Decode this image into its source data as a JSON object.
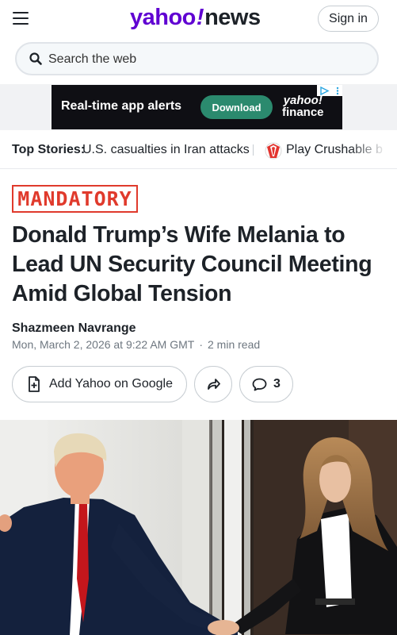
{
  "header": {
    "logo_left": "yahoo",
    "logo_bang": "!",
    "logo_right": "news",
    "signin_label": "Sign in"
  },
  "search": {
    "placeholder": "Search the web"
  },
  "ad": {
    "headline": "Real-time app alerts",
    "cta": "Download",
    "brand_line1": "yahoo!",
    "brand_line2": "finance"
  },
  "top_stories": {
    "label": "Top Stories:",
    "items": [
      {
        "text": "U.S. casualties in Iran attacks"
      },
      {
        "text": "Play Crushable b"
      }
    ]
  },
  "article": {
    "badge": "MANDATORY",
    "headline": "Donald Trump’s Wife Melania to Lead UN Security Council Meeting Amid Global Tension",
    "author": "Shazmeen Navrange",
    "date": "Mon, March 2, 2026 at 9:22 AM GMT",
    "separator": "·",
    "read_time": "2 min read"
  },
  "actions": {
    "add_yahoo_label": "Add Yahoo on Google",
    "comment_count": "3"
  },
  "colors": {
    "brand_purple": "#6001d2",
    "badge_red": "#e03a2c",
    "ad_button_green": "#2b8a6e",
    "border_gray": "#c7cdd2"
  }
}
